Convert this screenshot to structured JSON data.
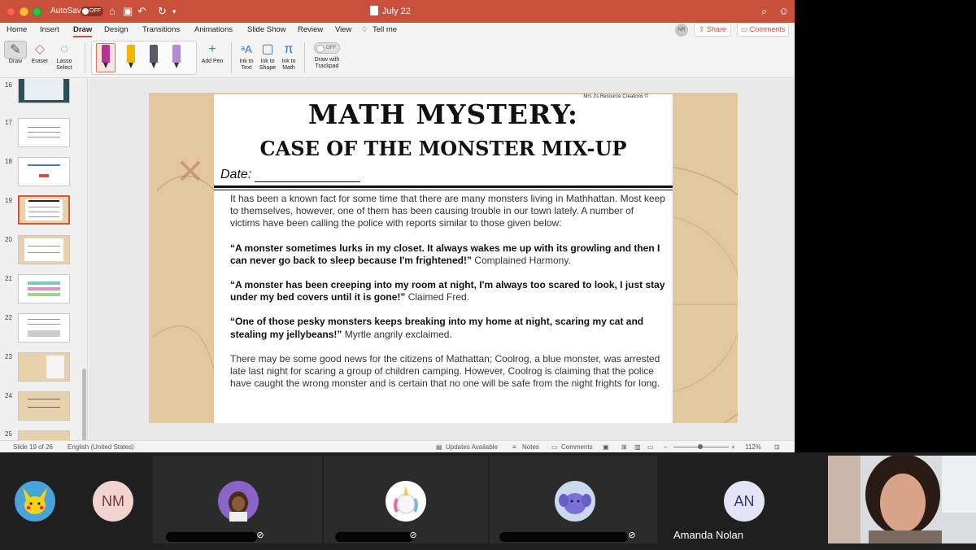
{
  "titlebar": {
    "autosave_label": "AutoSave",
    "autosave_state": "OFF",
    "doc_title": "July 22"
  },
  "tabs": [
    "Home",
    "Insert",
    "Draw",
    "Design",
    "Transitions",
    "Animations",
    "Slide Show",
    "Review",
    "View"
  ],
  "active_tab": "Draw",
  "tell_me": "Tell me",
  "user_initials": "NR",
  "share_label": "Share",
  "comments_label": "Comments",
  "ribbon": {
    "draw": "Draw",
    "eraser": "Eraser",
    "lasso_1": "Lasso",
    "lasso_2": "Select",
    "add_pen": "Add Pen",
    "ink_text_1": "Ink to",
    "ink_text_2": "Text",
    "ink_shape_1": "Ink to",
    "ink_shape_2": "Shape",
    "ink_math_1": "Ink to",
    "ink_math_2": "Math",
    "trackpad_1": "Draw with",
    "trackpad_2": "Trackpad",
    "trackpad_state": "OFF",
    "pen_colors": [
      "#b8338f",
      "#f2b600",
      "#555b66",
      "#b48ad8"
    ]
  },
  "thumbnails": [
    {
      "num": "16"
    },
    {
      "num": "17"
    },
    {
      "num": "18"
    },
    {
      "num": "19"
    },
    {
      "num": "20"
    },
    {
      "num": "21"
    },
    {
      "num": "22"
    },
    {
      "num": "23"
    },
    {
      "num": "24"
    },
    {
      "num": "25"
    }
  ],
  "selected_slide": "19",
  "slide": {
    "credit": "Mrs J's Resource Creations ©",
    "title_line1": "MATH MYSTERY:",
    "title_line2": "CASE OF THE MONSTER MIX-UP",
    "date_label": "Date:",
    "intro": "It has been a known fact for some time that there are many monsters living in Mathhattan. Most keep to themselves, however, one of them has been causing trouble in our town lately. A number of victims have been calling the police with reports similar to those given below:",
    "quote1": "“A monster sometimes lurks in my closet. It always wakes me up with its growling and then I can never go back to sleep because I'm frightened!”",
    "quote1_attr": " Complained Harmony.",
    "quote2": "“A monster has been creeping into my room at night, I'm always too scared to look, I just stay under my bed covers until it is gone!”",
    "quote2_attr": " Claimed Fred.",
    "quote3": "“One of those pesky monsters keeps breaking into my home at night, scaring my cat and stealing my jellybeans!”",
    "quote3_attr": " Myrtle angrily exclaimed.",
    "closing": "There may be some good news for the citizens of Mathattan; Coolrog, a blue monster, was arrested late last night for scaring a group of children camping. However, Coolrog is claiming that the police have caught the wrong monster and is certain that no one will be safe from the night frights for long."
  },
  "statusbar": {
    "slide_info": "Slide 19 of 26",
    "language": "English (United States)",
    "updates": "Updates Available",
    "notes": "Notes",
    "comments": "Comments",
    "zoom": "112%"
  },
  "participants": [
    {
      "name": "",
      "initials": ""
    },
    {
      "name": "",
      "initials": "NM"
    },
    {
      "name": "",
      "initials": ""
    },
    {
      "name": "",
      "initials": ""
    },
    {
      "name": "",
      "initials": ""
    },
    {
      "name": "Amanda Nolan",
      "initials": "AN"
    }
  ]
}
